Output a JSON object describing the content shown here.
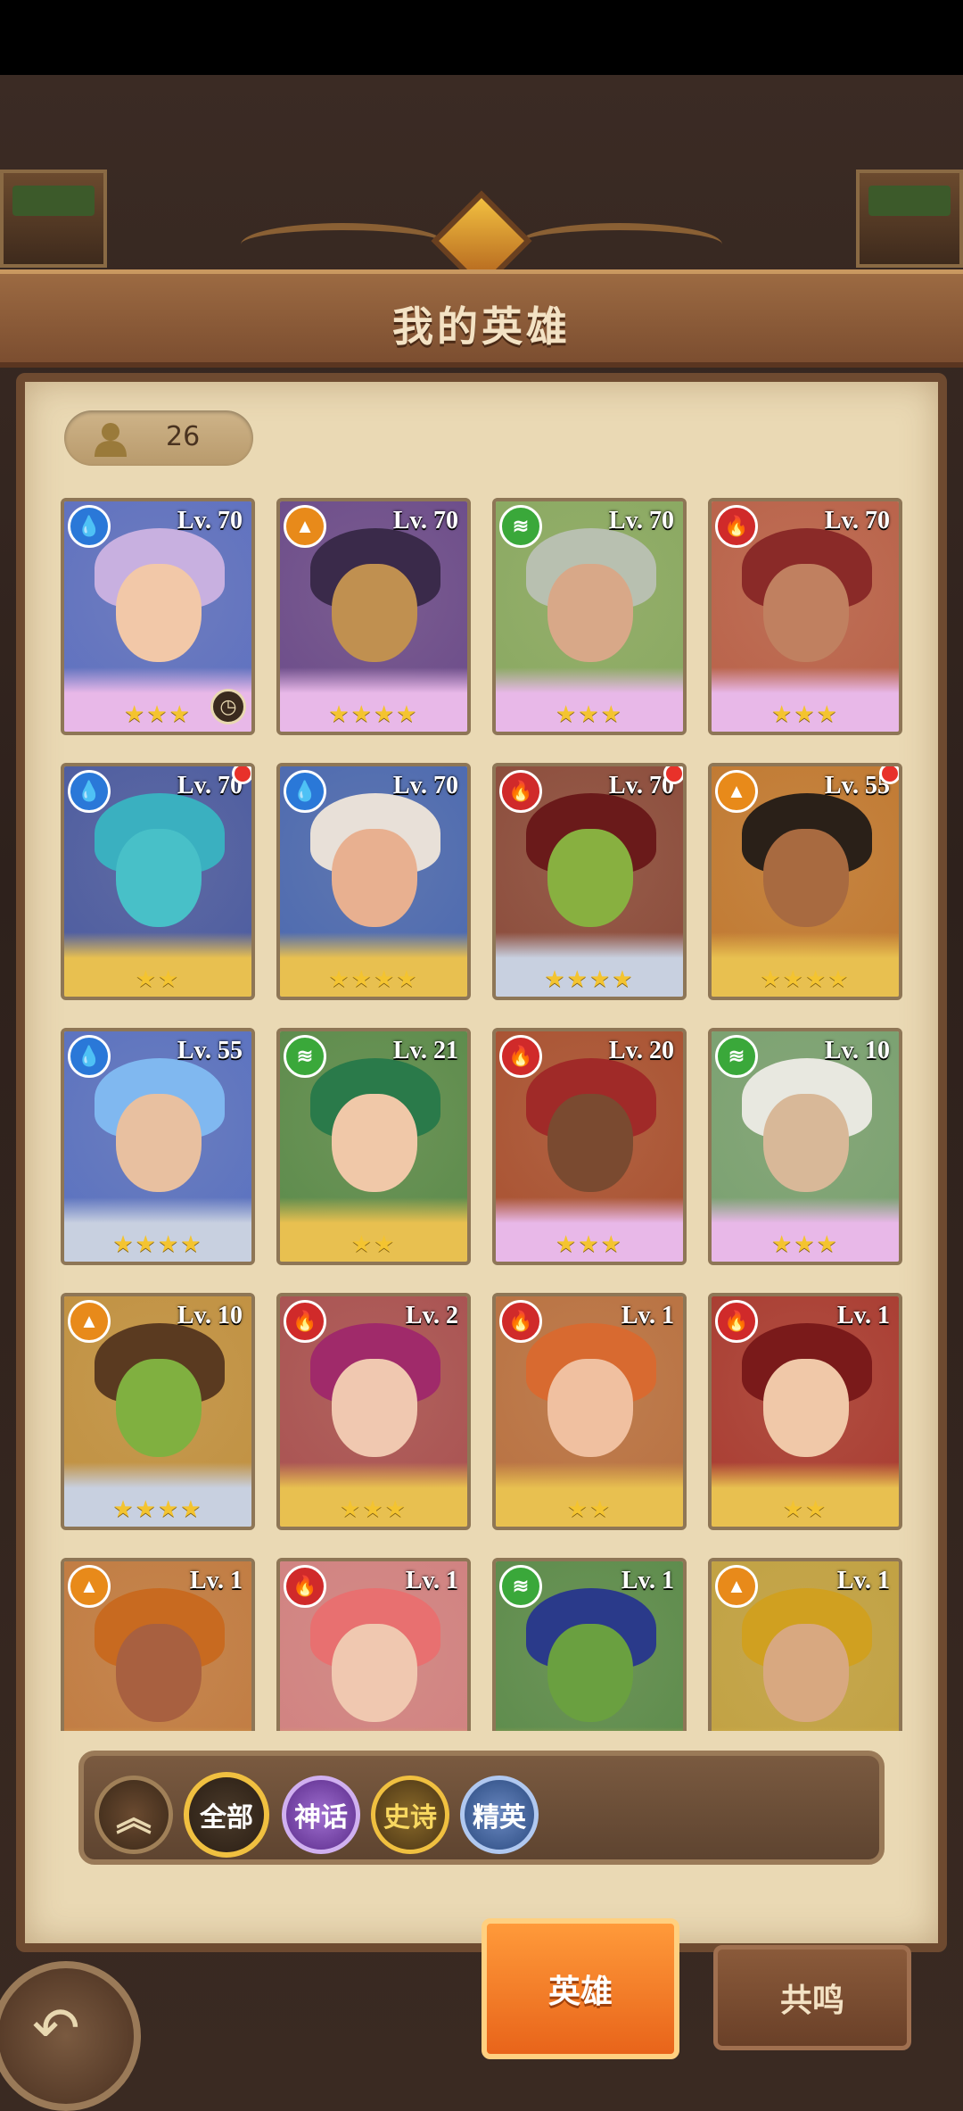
{
  "page": {
    "title": "我的英雄"
  },
  "counter": {
    "icon": "person-icon",
    "value": "26"
  },
  "heroes": [
    {
      "element": "water",
      "level": "Lv. 70",
      "stars": "★★★",
      "rarity": "myth",
      "dot": false,
      "clock": true,
      "bg": "#5c6fc0",
      "hair": "#c8b0e0",
      "skin": "#f2c8a8"
    },
    {
      "element": "fire-orange",
      "level": "Lv. 70",
      "stars": "★★★★",
      "rarity": "myth",
      "dot": false,
      "clock": false,
      "bg": "#6a4a8a",
      "hair": "#3a2a4a",
      "skin": "#c09050"
    },
    {
      "element": "wind",
      "level": "Lv. 70",
      "stars": "★★★",
      "rarity": "myth",
      "dot": false,
      "clock": false,
      "bg": "#88a860",
      "hair": "#b8c0b0",
      "skin": "#d8a888"
    },
    {
      "element": "fire",
      "level": "Lv. 70",
      "stars": "★★★",
      "rarity": "myth",
      "dot": false,
      "clock": false,
      "bg": "#b86048",
      "hair": "#8a2a28",
      "skin": "#c08060"
    },
    {
      "element": "water",
      "level": "Lv. 70",
      "stars": "★★",
      "rarity": "epic",
      "dot": true,
      "clock": false,
      "bg": "#4a5aa0",
      "hair": "#3ab0c0",
      "skin": "#48c0c8"
    },
    {
      "element": "water",
      "level": "Lv. 70",
      "stars": "★★★★",
      "rarity": "epic",
      "dot": false,
      "clock": false,
      "bg": "#4a68b0",
      "hair": "#e8e0d8",
      "skin": "#e8b090"
    },
    {
      "element": "fire",
      "level": "Lv. 70",
      "stars": "★★★★",
      "rarity": "elite",
      "dot": true,
      "clock": false,
      "bg": "#8a4a3a",
      "hair": "#6a1a1a",
      "skin": "#88b040"
    },
    {
      "element": "fire-orange",
      "level": "Lv. 55",
      "stars": "★★★★",
      "rarity": "epic",
      "dot": true,
      "clock": false,
      "bg": "#c07830",
      "hair": "#2a2018",
      "skin": "#a86a40"
    },
    {
      "element": "water",
      "level": "Lv. 55",
      "stars": "★★★★",
      "rarity": "elite",
      "dot": false,
      "clock": false,
      "bg": "#5870c0",
      "hair": "#80b8f0",
      "skin": "#e8c0a0"
    },
    {
      "element": "wind",
      "level": "Lv. 21",
      "stars": "★★",
      "rarity": "epic",
      "dot": false,
      "clock": false,
      "bg": "#5a8a4a",
      "hair": "#2a7a4a",
      "skin": "#f0c8a8"
    },
    {
      "element": "fire",
      "level": "Lv. 20",
      "stars": "★★★",
      "rarity": "myth",
      "dot": false,
      "clock": false,
      "bg": "#a85030",
      "hair": "#a02a28",
      "skin": "#7a4a30"
    },
    {
      "element": "wind",
      "level": "Lv. 10",
      "stars": "★★★",
      "rarity": "myth",
      "dot": false,
      "clock": false,
      "bg": "#78a070",
      "hair": "#e8e8e0",
      "skin": "#d8b898"
    },
    {
      "element": "fire-orange",
      "level": "Lv. 10",
      "stars": "★★★★",
      "rarity": "elite",
      "dot": false,
      "clock": false,
      "bg": "#c09040",
      "hair": "#5a3a20",
      "skin": "#80b040"
    },
    {
      "element": "fire",
      "level": "Lv. 2",
      "stars": "★★★",
      "rarity": "epic",
      "dot": false,
      "clock": false,
      "bg": "#a85050",
      "hair": "#a02a6a",
      "skin": "#f0c8b0"
    },
    {
      "element": "fire",
      "level": "Lv. 1",
      "stars": "★★",
      "rarity": "epic",
      "dot": false,
      "clock": false,
      "bg": "#b87040",
      "hair": "#d86a30",
      "skin": "#f0c0a0"
    },
    {
      "element": "fire",
      "level": "Lv. 1",
      "stars": "★★",
      "rarity": "epic",
      "dot": false,
      "clock": false,
      "bg": "#a83a30",
      "hair": "#7a1a1a",
      "skin": "#f0c8a8"
    },
    {
      "element": "fire-orange",
      "level": "Lv. 1",
      "stars": "",
      "rarity": "epic",
      "dot": false,
      "clock": false,
      "bg": "#c07a40",
      "hair": "#c86a20",
      "skin": "#a86040"
    },
    {
      "element": "fire",
      "level": "Lv. 1",
      "stars": "",
      "rarity": "epic",
      "dot": false,
      "clock": false,
      "bg": "#d08080",
      "hair": "#e87070",
      "skin": "#f0c8b0"
    },
    {
      "element": "wind",
      "level": "Lv. 1",
      "stars": "",
      "rarity": "epic",
      "dot": false,
      "clock": false,
      "bg": "#5a8a4a",
      "hair": "#2a3a8a",
      "skin": "#6aa040"
    },
    {
      "element": "fire-orange",
      "level": "Lv. 1",
      "stars": "",
      "rarity": "epic",
      "dot": false,
      "clock": false,
      "bg": "#c0a040",
      "hair": "#d0a020",
      "skin": "#d8a880"
    }
  ],
  "filters": [
    {
      "name": "collapse",
      "label": "",
      "icon": "double-chevron-up-icon"
    },
    {
      "name": "all",
      "label": "全部"
    },
    {
      "name": "myth",
      "label": "神话"
    },
    {
      "name": "epic",
      "label": "史诗"
    },
    {
      "name": "elite",
      "label": "精英"
    }
  ],
  "tabs": {
    "hero": "英雄",
    "resonance": "共鸣"
  },
  "back": {
    "icon": "back-arrow-icon"
  },
  "colors": {
    "water": "#2a78d8",
    "fire": "#d02a2a",
    "fire-orange": "#e88a1a",
    "wind": "#3aa83a",
    "myth": "#e8b8e8",
    "epic": "#e8c050",
    "elite": "#c8d0e0"
  }
}
